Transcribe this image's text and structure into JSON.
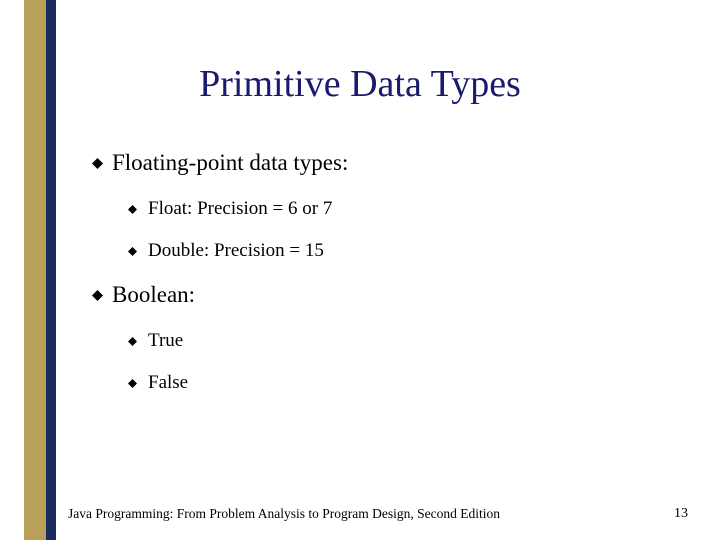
{
  "title": "Primitive Data Types",
  "bullets": {
    "b1": "Floating-point data types:",
    "b1a": "Float: Precision = 6 or 7",
    "b1b": "Double: Precision = 15",
    "b2": "Boolean:",
    "b2a": "True",
    "b2b": "False"
  },
  "footer": {
    "source": "Java Programming: From Problem Analysis to Program Design, Second Edition",
    "page": "13"
  }
}
